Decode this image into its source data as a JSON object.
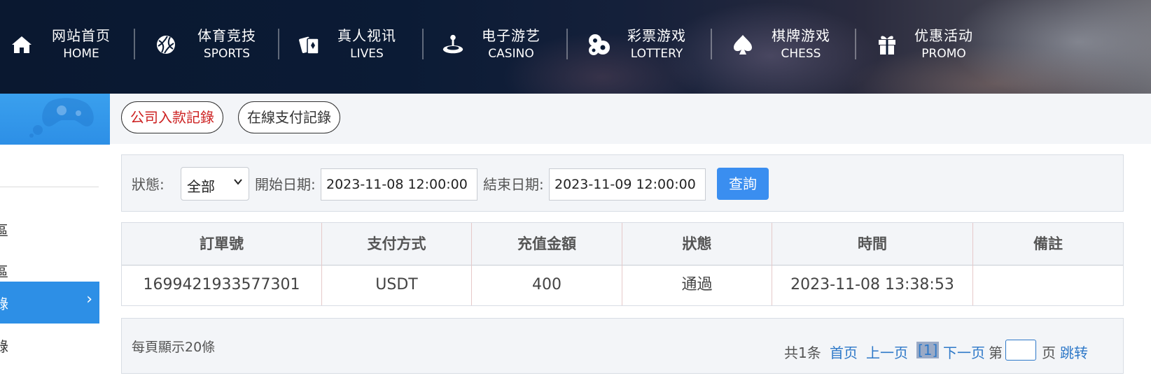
{
  "nav": {
    "items": [
      {
        "zh": "网站首页",
        "en": "HOME",
        "icon": "home-icon"
      },
      {
        "zh": "体育竞技",
        "en": "SPORTS",
        "icon": "ball-icon"
      },
      {
        "zh": "真人视讯",
        "en": "LIVES",
        "icon": "cards-icon"
      },
      {
        "zh": "电子游艺",
        "en": "CASINO",
        "icon": "joystick-icon"
      },
      {
        "zh": "彩票游戏",
        "en": "LOTTERY",
        "icon": "dice-icon"
      },
      {
        "zh": "棋牌游戏",
        "en": "CHESS",
        "icon": "spade-icon"
      },
      {
        "zh": "优惠活动",
        "en": "PROMO",
        "icon": "gift-icon"
      }
    ]
  },
  "sidebar": {
    "items": [
      {
        "label": "區"
      },
      {
        "label": "區"
      },
      {
        "label": "錄",
        "active": true
      },
      {
        "label": "錄"
      }
    ]
  },
  "tabs": [
    {
      "label": "公司入款記錄",
      "active": true
    },
    {
      "label": "在線支付記錄",
      "active": false
    }
  ],
  "filter": {
    "status_label": "狀態:",
    "status_value": "全部",
    "start_label": "開始日期:",
    "start_value": "2023-11-08 12:00:00",
    "end_label": "結束日期:",
    "end_value": "2023-11-09 12:00:00",
    "search_label": "查詢"
  },
  "table": {
    "headers": [
      "訂單號",
      "支付方式",
      "充值金額",
      "狀態",
      "時間",
      "備註"
    ],
    "rows": [
      [
        "1699421933577301",
        "USDT",
        "400",
        "通過",
        "2023-11-08 13:38:53",
        ""
      ]
    ]
  },
  "pager": {
    "per_page": "每頁顯示20條",
    "total": "共1条",
    "first": "首页",
    "prev": "上一页",
    "current": "[1]",
    "next": "下一页",
    "page_prefix": "第",
    "page_suffix": "页",
    "jump": "跳转"
  },
  "colors": {
    "accent": "#2d8fe6",
    "active_tab_text": "#cc1f1f",
    "link": "#2d78c8"
  }
}
